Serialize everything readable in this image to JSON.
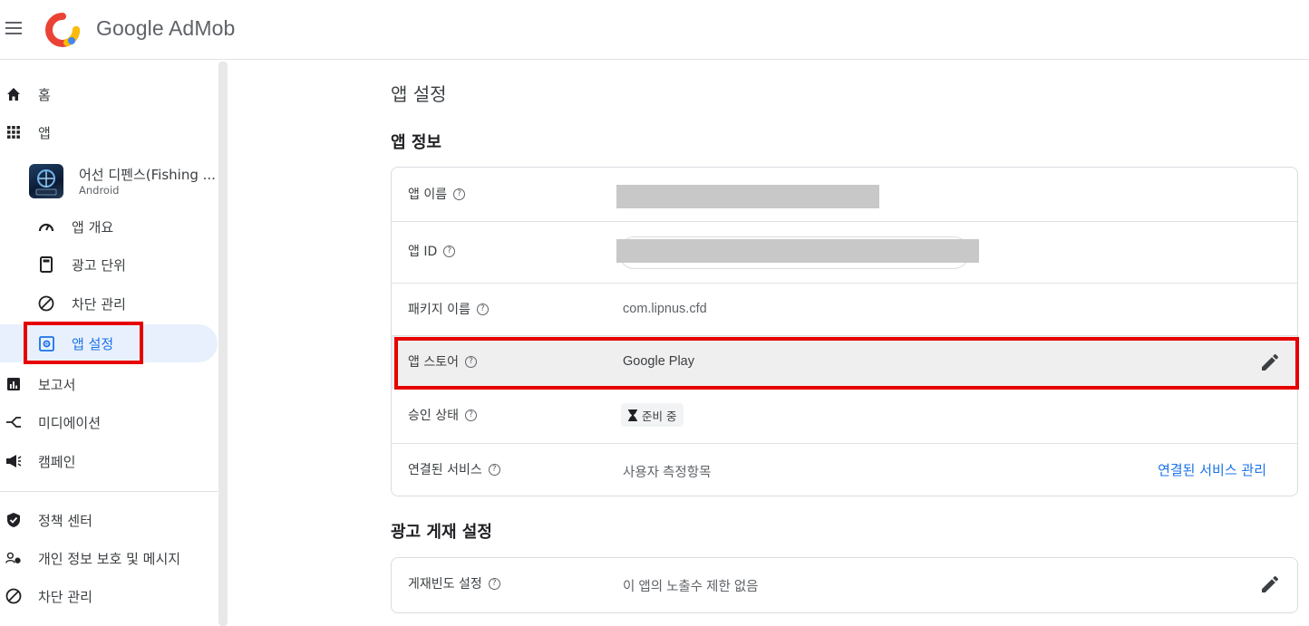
{
  "header": {
    "brand": "Google AdMob"
  },
  "sidebar": {
    "items": [
      {
        "label": "홈",
        "icon": "home-icon"
      },
      {
        "label": "앱",
        "icon": "apps-grid-icon"
      },
      {
        "label": "앱 개요",
        "icon": "speedometer-icon"
      },
      {
        "label": "광고 단위",
        "icon": "ad-unit-icon"
      },
      {
        "label": "차단 관리",
        "icon": "block-icon"
      },
      {
        "label": "앱 설정",
        "icon": "app-settings-icon"
      },
      {
        "label": "보고서",
        "icon": "reports-icon"
      },
      {
        "label": "미디에이션",
        "icon": "mediation-icon"
      },
      {
        "label": "캠페인",
        "icon": "campaign-icon"
      },
      {
        "label": "정책 센터",
        "icon": "policy-shield-icon"
      },
      {
        "label": "개인 정보 보호 및 메시지",
        "icon": "privacy-icon"
      },
      {
        "label": "차단 관리",
        "icon": "block-icon"
      }
    ],
    "app": {
      "name": "어선 디펜스(Fishing ...",
      "platform": "Android"
    },
    "active_item": "앱 설정"
  },
  "main": {
    "page_title": "앱 설정",
    "app_info": {
      "title": "앱 정보",
      "rows": [
        {
          "label": "앱 이름",
          "value": ""
        },
        {
          "label": "앱 ID",
          "value": ""
        },
        {
          "label": "패키지 이름",
          "value": "com.lipnus.cfd"
        },
        {
          "label": "앱 스토어",
          "value": "Google Play"
        },
        {
          "label": "승인 상태",
          "value": "준비 중"
        },
        {
          "label": "연결된 서비스",
          "value": "사용자 측정항목",
          "action": "연결된 서비스 관리"
        }
      ]
    },
    "ad_serving": {
      "title": "광고 게재 설정",
      "rows": [
        {
          "label": "게재빈도 설정",
          "value": "이 앱의 노출수 제한 없음"
        }
      ]
    }
  },
  "colors": {
    "accent": "#1a73e8",
    "highlight": "#e60000",
    "active_bg": "#e8f0fe"
  }
}
